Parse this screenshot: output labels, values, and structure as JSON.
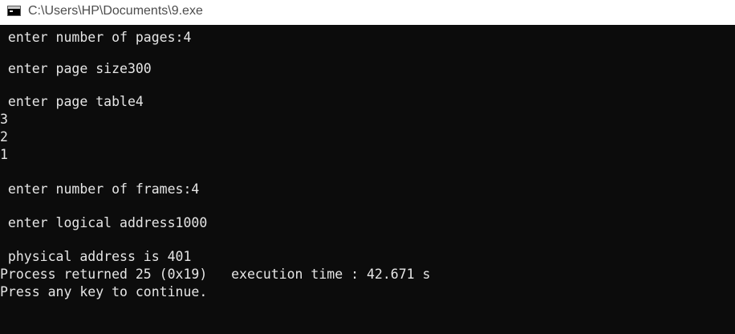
{
  "window": {
    "title": "C:\\Users\\HP\\Documents\\9.exe",
    "icon": "console-app-icon"
  },
  "console": {
    "colors": {
      "background": "#0c0c0c",
      "text": "#e6e6e6"
    },
    "lines": [
      " enter number of pages:4",
      " enter page size300",
      " enter page table4",
      "3",
      "2",
      "1",
      " enter number of frames:4",
      " enter logical address1000",
      " physical address is 401",
      "Process returned 25 (0x19)   execution time : 42.671 s",
      "Press any key to continue."
    ]
  }
}
